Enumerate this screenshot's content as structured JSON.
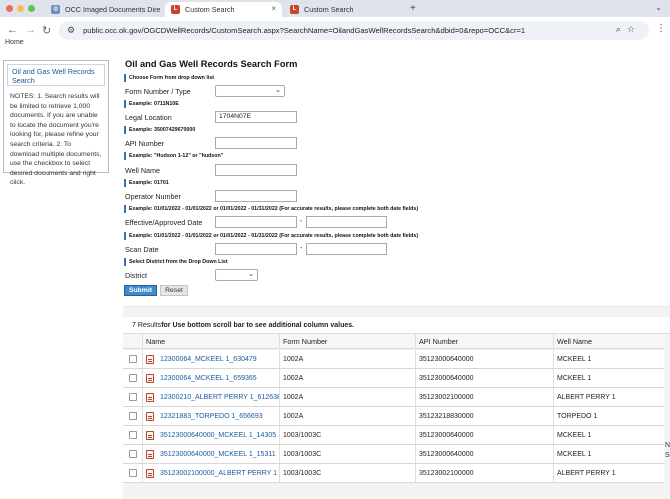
{
  "browser": {
    "tabs": [
      {
        "label": "OCC Imaged Documents Dire",
        "icon": "globe-icon",
        "active": false
      },
      {
        "label": "Custom Search",
        "icon": "laserfiche-icon",
        "active": true
      },
      {
        "label": "Custom Search",
        "icon": "laserfiche-icon",
        "active": false
      }
    ],
    "url": "public.occ.ok.gov/OGCDWellRecords/CustomSearch.aspx?SearchName=OilandGasWellRecordsSearch&dbid=0&repo=OCC&cr=1"
  },
  "home_cut_text": "Home",
  "sidebar": {
    "link_label": "Oil and Gas Well Records Search",
    "notes": "NOTES: 1. Search results will be limited to retrieve 1,000 documents. If you are unable to locate the document you're looking for, please refine your search criteria. 2. To download multiple documents, use the checkbox to select desired documents and right click."
  },
  "form": {
    "title": "Oil and Gas Well Records Search Form",
    "hint_form": "Choose Form from drop down list",
    "form_number_label": "Form Number / Type",
    "hint_legal": "Example: 0711N10E",
    "legal_label": "Legal Location",
    "legal_value": "1704N07E",
    "hint_api": "Example: 35007429670000",
    "api_label": "API Number",
    "hint_well": "Example: \"Hudson 1-12\" or \"hudson\"",
    "well_label": "Well Name",
    "hint_operator": "Example: 01701",
    "operator_label": "Operator Number",
    "hint_effective": "Example: 01/01/2022 - 01/01/2022 or 01/01/2022 - 01/31/2022 (For accurate results, please complete both date fields)",
    "effective_label": "Effective/Approved Date",
    "hint_scan": "Example: 01/01/2022 - 01/01/2022 or 01/01/2022 - 01/31/2022 (For accurate results, please complete both date fields)",
    "scan_label": "Scan Date",
    "hint_district": "Select District from the Drop Down List",
    "district_label": "District",
    "date_separator": "-",
    "submit_label": "Submit",
    "reset_label": "Reset"
  },
  "results": {
    "count_text": "7 Results",
    "count_hint": "for Use bottom scroll bar to see additional column values.",
    "columns": [
      "Name",
      "Form Number",
      "API Number",
      "Well Name"
    ],
    "rows": [
      {
        "name": "12300064_MCKEEL 1_630479",
        "form": "1002A",
        "api": "35123000640000",
        "well": "MCKEEL 1"
      },
      {
        "name": "12300064_MCKEEL 1_659365",
        "form": "1002A",
        "api": "35123000640000",
        "well": "MCKEEL 1"
      },
      {
        "name": "12300210_ALBERT PERRY 1_612638",
        "form": "1002A",
        "api": "35123002100000",
        "well": "ALBERT PERRY 1"
      },
      {
        "name": "12321883_TORPEDO 1_656693",
        "form": "1002A",
        "api": "35123218830000",
        "well": "TORPEDO 1"
      },
      {
        "name": "35123000640000_MCKEEL 1_14305",
        "form": "1003/1003C",
        "api": "35123000640000",
        "well": "MCKEEL 1"
      },
      {
        "name": "35123000640000_MCKEEL 1_15311",
        "form": "1003/1003C",
        "api": "35123000640000",
        "well": "MCKEEL 1"
      },
      {
        "name": "35123002100000_ALBERT PERRY 1",
        "form": "1003/1003C",
        "api": "35123002100000",
        "well": "ALBERT PERRY 1"
      }
    ],
    "edge_text": "N",
    "edge_text2": "S"
  }
}
